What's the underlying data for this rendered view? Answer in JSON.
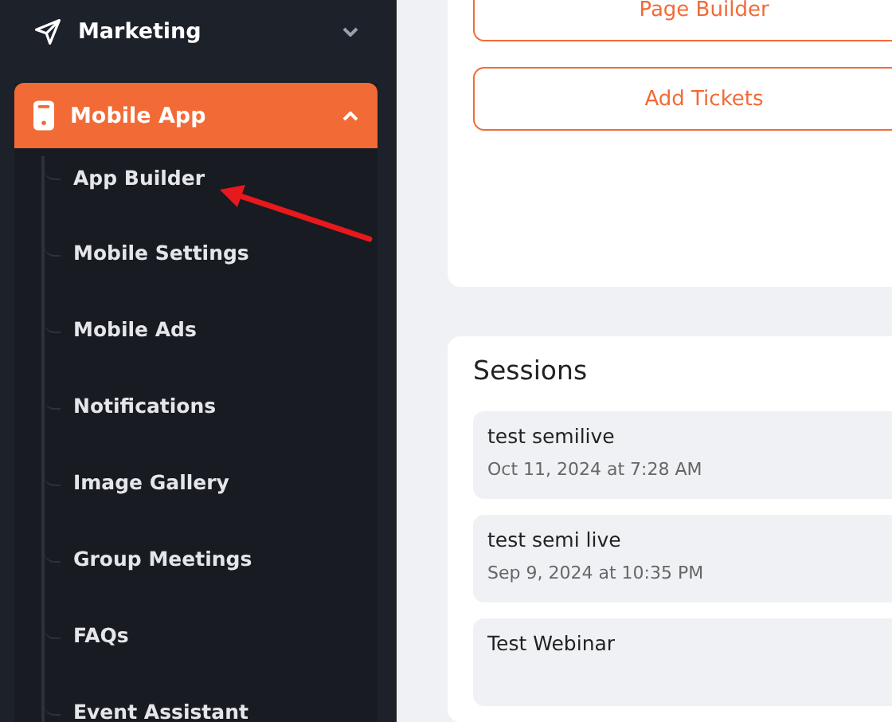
{
  "sidebar": {
    "items": [
      {
        "label": "Marketing",
        "expanded": false
      },
      {
        "label": "Mobile App",
        "expanded": true,
        "children": [
          {
            "label": "App Builder"
          },
          {
            "label": "Mobile Settings"
          },
          {
            "label": "Mobile Ads"
          },
          {
            "label": "Notifications"
          },
          {
            "label": "Image Gallery"
          },
          {
            "label": "Group Meetings"
          },
          {
            "label": "FAQs"
          },
          {
            "label": "Event Assistant"
          }
        ]
      }
    ]
  },
  "actions": [
    "Page Builder",
    "Add Tickets"
  ],
  "sessions": {
    "title": "Sessions",
    "items": [
      {
        "name": "test semilive",
        "date": "Oct 11, 2024 at 7:28 AM"
      },
      {
        "name": "test semi live",
        "date": "Sep 9, 2024 at 10:35 PM"
      },
      {
        "name": "Test Webinar"
      }
    ]
  }
}
